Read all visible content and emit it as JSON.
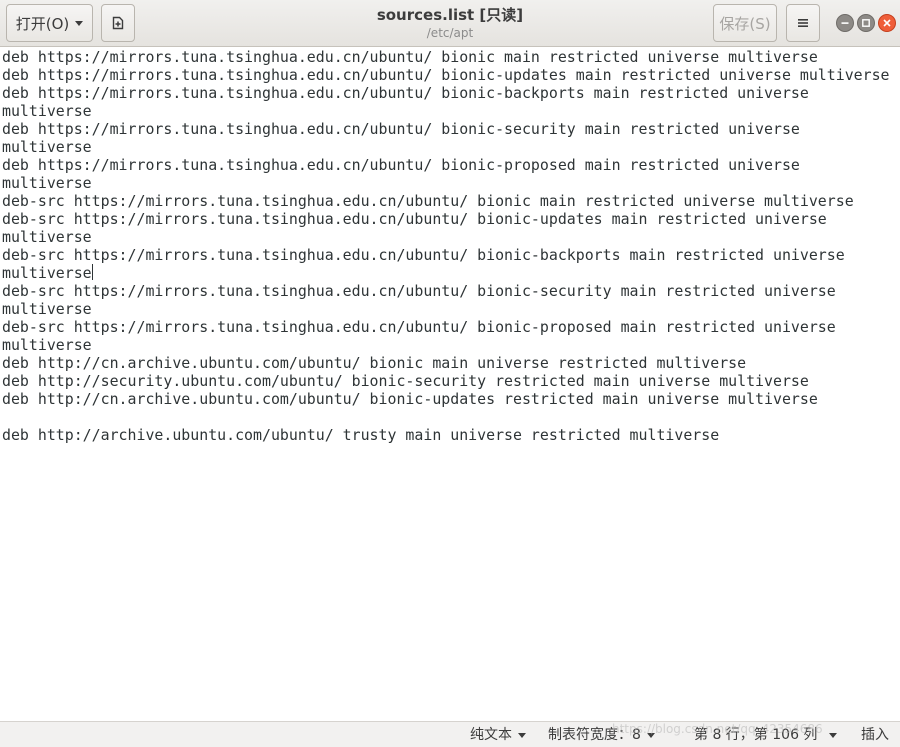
{
  "header": {
    "open_label": "打开(O)",
    "save_label": "保存(S)",
    "title": "sources.list [只读]",
    "subtitle": "/etc/apt"
  },
  "editor": {
    "lines": [
      "deb https://mirrors.tuna.tsinghua.edu.cn/ubuntu/ bionic main restricted universe multiverse",
      "deb https://mirrors.tuna.tsinghua.edu.cn/ubuntu/ bionic-updates main restricted universe multiverse",
      "deb https://mirrors.tuna.tsinghua.edu.cn/ubuntu/ bionic-backports main restricted universe",
      "multiverse",
      "deb https://mirrors.tuna.tsinghua.edu.cn/ubuntu/ bionic-security main restricted universe",
      "multiverse",
      "deb https://mirrors.tuna.tsinghua.edu.cn/ubuntu/ bionic-proposed main restricted universe",
      "multiverse",
      "deb-src https://mirrors.tuna.tsinghua.edu.cn/ubuntu/ bionic main restricted universe multiverse",
      "deb-src https://mirrors.tuna.tsinghua.edu.cn/ubuntu/ bionic-updates main restricted universe",
      "multiverse",
      "deb-src https://mirrors.tuna.tsinghua.edu.cn/ubuntu/ bionic-backports main restricted universe",
      "multiverse",
      "deb-src https://mirrors.tuna.tsinghua.edu.cn/ubuntu/ bionic-security main restricted universe",
      "multiverse",
      "deb-src https://mirrors.tuna.tsinghua.edu.cn/ubuntu/ bionic-proposed main restricted universe",
      "multiverse",
      "deb http://cn.archive.ubuntu.com/ubuntu/ bionic main universe restricted multiverse",
      "deb http://security.ubuntu.com/ubuntu/ bionic-security restricted main universe multiverse",
      "deb http://cn.archive.ubuntu.com/ubuntu/ bionic-updates restricted main universe multiverse",
      "",
      "deb http://archive.ubuntu.com/ubuntu/ trusty main universe restricted multiverse"
    ]
  },
  "statusbar": {
    "language": "纯文本",
    "tab_width": "制表符宽度：8",
    "position": "第 8 行，第 106 列",
    "insert_mode": "插入"
  },
  "watermark": "https://blog.csdn.net/qq_42354686",
  "colors": {
    "close_button": "#ef5f3a",
    "header_bg": "#e9e7e3",
    "text": "#2e3436"
  },
  "icons": {
    "new_document": "new-document-icon",
    "menu": "hamburger-menu-icon",
    "minimize": "minimize-icon",
    "maximize": "maximize-icon",
    "close": "close-icon"
  }
}
